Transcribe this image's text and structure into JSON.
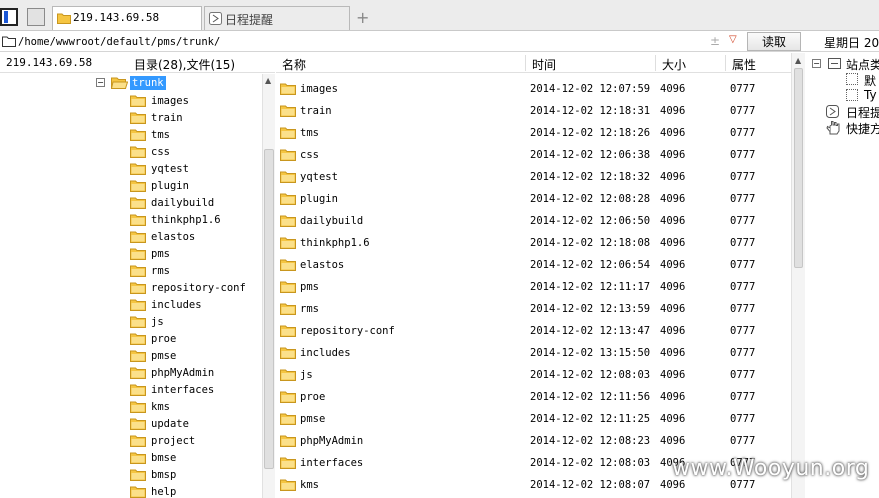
{
  "tabs": [
    {
      "label": "219.143.69.58",
      "active": true
    },
    {
      "label": "日程提醒",
      "active": false
    }
  ],
  "address": {
    "path": "/home/wwwroot/default/pms/trunk/",
    "read_label": "读取"
  },
  "weekday_label": "星期日 20",
  "host": "219.143.69.58",
  "tree_header": "目录(28),文件(15)",
  "columns": {
    "name": "名称",
    "time": "时间",
    "size": "大小",
    "attr": "属性"
  },
  "tree": {
    "root": "trunk",
    "items": [
      "images",
      "train",
      "tms",
      "css",
      "yqtest",
      "plugin",
      "dailybuild",
      "thinkphp1.6",
      "elastos",
      "pms",
      "rms",
      "repository-conf",
      "includes",
      "js",
      "proe",
      "pmse",
      "phpMyAdmin",
      "interfaces",
      "kms",
      "update",
      "project",
      "bmse",
      "bmsp",
      "help"
    ]
  },
  "files": [
    {
      "name": "images",
      "time": "2014-12-02 12:07:59",
      "size": "4096",
      "attr": "0777"
    },
    {
      "name": "train",
      "time": "2014-12-02 12:18:31",
      "size": "4096",
      "attr": "0777"
    },
    {
      "name": "tms",
      "time": "2014-12-02 12:18:26",
      "size": "4096",
      "attr": "0777"
    },
    {
      "name": "css",
      "time": "2014-12-02 12:06:38",
      "size": "4096",
      "attr": "0777"
    },
    {
      "name": "yqtest",
      "time": "2014-12-02 12:18:32",
      "size": "4096",
      "attr": "0777"
    },
    {
      "name": "plugin",
      "time": "2014-12-02 12:08:28",
      "size": "4096",
      "attr": "0777"
    },
    {
      "name": "dailybuild",
      "time": "2014-12-02 12:06:50",
      "size": "4096",
      "attr": "0777"
    },
    {
      "name": "thinkphp1.6",
      "time": "2014-12-02 12:18:08",
      "size": "4096",
      "attr": "0777"
    },
    {
      "name": "elastos",
      "time": "2014-12-02 12:06:54",
      "size": "4096",
      "attr": "0777"
    },
    {
      "name": "pms",
      "time": "2014-12-02 12:11:17",
      "size": "4096",
      "attr": "0777"
    },
    {
      "name": "rms",
      "time": "2014-12-02 12:13:59",
      "size": "4096",
      "attr": "0777"
    },
    {
      "name": "repository-conf",
      "time": "2014-12-02 12:13:47",
      "size": "4096",
      "attr": "0777"
    },
    {
      "name": "includes",
      "time": "2014-12-02 13:15:50",
      "size": "4096",
      "attr": "0777"
    },
    {
      "name": "js",
      "time": "2014-12-02 12:08:03",
      "size": "4096",
      "attr": "0777"
    },
    {
      "name": "proe",
      "time": "2014-12-02 12:11:56",
      "size": "4096",
      "attr": "0777"
    },
    {
      "name": "pmse",
      "time": "2014-12-02 12:11:25",
      "size": "4096",
      "attr": "0777"
    },
    {
      "name": "phpMyAdmin",
      "time": "2014-12-02 12:08:23",
      "size": "4096",
      "attr": "0777"
    },
    {
      "name": "interfaces",
      "time": "2014-12-02 12:08:03",
      "size": "4096",
      "attr": "0777"
    },
    {
      "name": "kms",
      "time": "2014-12-02 12:08:07",
      "size": "4096",
      "attr": "0777"
    }
  ],
  "side_panel": {
    "site_category": "站点类",
    "default_label": "默",
    "type_label": "Ty",
    "schedule_label": "日程提",
    "shortcut_label": "快捷方"
  },
  "watermark": "www.Wooyun.org",
  "colors": {
    "selection": "#3399ff",
    "folder": "#f5c542",
    "folder_edge": "#c8961e"
  },
  "icons": {
    "folder": "folder-icon",
    "schedule": "clock-icon",
    "shortcut": "hand-icon"
  }
}
